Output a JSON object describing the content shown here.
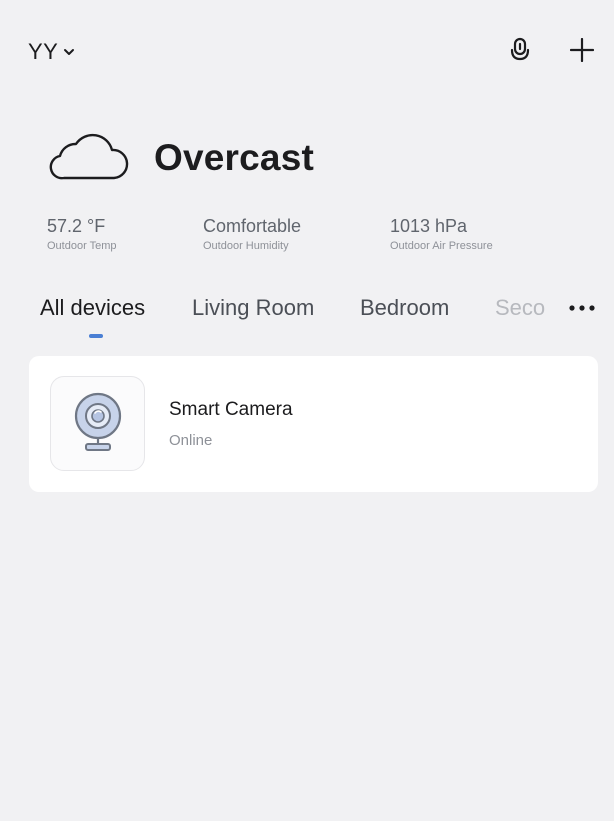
{
  "header": {
    "home_name": "YY"
  },
  "icons": {
    "chevron": "chevron-down-icon",
    "mic": "microphone-icon",
    "add": "plus-icon",
    "weather": "cloud-icon",
    "more": "ellipsis-icon",
    "camera": "camera-icon"
  },
  "weather": {
    "condition": "Overcast",
    "stats": [
      {
        "value": "57.2 °F",
        "label": "Outdoor Temp"
      },
      {
        "value": "Comfortable",
        "label": "Outdoor Humidity"
      },
      {
        "value": "1013 hPa",
        "label": "Outdoor Air Pressure"
      }
    ]
  },
  "tabs": [
    {
      "label": "All devices",
      "active": true
    },
    {
      "label": "Living Room",
      "active": false
    },
    {
      "label": "Bedroom",
      "active": false
    },
    {
      "label": "Seco",
      "active": false
    }
  ],
  "devices": [
    {
      "name": "Smart Camera",
      "status": "Online"
    }
  ],
  "colors": {
    "background": "#f1f1f3",
    "accent": "#4a7fd4",
    "card": "#ffffff"
  }
}
